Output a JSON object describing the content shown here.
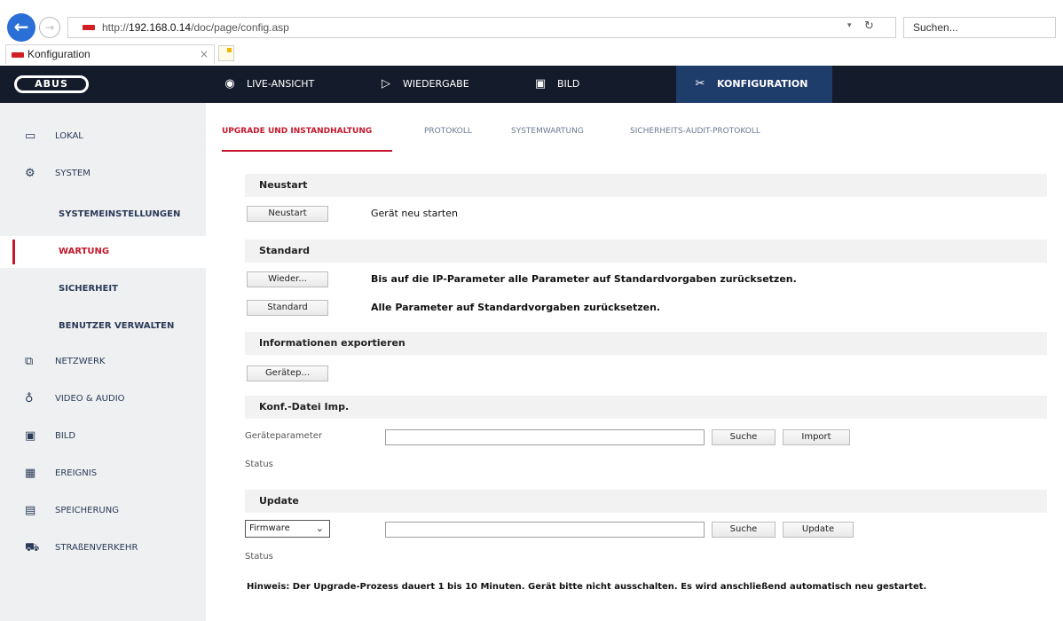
{
  "browser": {
    "url_prefix": "http://",
    "url_host": "192.168.0.14",
    "url_path": "/doc/page/config.asp",
    "address_dropdown_icon": "chevron-down-icon",
    "refresh_icon": "refresh-icon",
    "search_placeholder": "Suchen...",
    "tab_title": "Konfiguration",
    "tab_close": "×"
  },
  "header": {
    "logo": "ABUS",
    "nav": [
      {
        "label": "LIVE-ANSICHT",
        "icon": "eye-icon"
      },
      {
        "label": "WIEDERGABE",
        "icon": "play-icon"
      },
      {
        "label": "BILD",
        "icon": "image-icon"
      },
      {
        "label": "KONFIGURATION",
        "icon": "tools-icon",
        "active": true
      }
    ]
  },
  "sidebar": {
    "items": [
      {
        "label": "LOKAL",
        "icon": "monitor-icon"
      },
      {
        "label": "SYSTEM",
        "icon": "gear-icon"
      },
      {
        "label": "SYSTEMEINSTELLUNGEN"
      },
      {
        "label": "WARTUNG",
        "active": true
      },
      {
        "label": "SICHERHEIT"
      },
      {
        "label": "BENUTZER VERWALTEN"
      },
      {
        "label": "NETZWERK",
        "icon": "network-icon"
      },
      {
        "label": "VIDEO & AUDIO",
        "icon": "microphone-icon"
      },
      {
        "label": "BILD",
        "icon": "image-icon"
      },
      {
        "label": "EREIGNIS",
        "icon": "calendar-icon"
      },
      {
        "label": "SPEICHERUNG",
        "icon": "storage-icon"
      },
      {
        "label": "STRAßENVERKEHR",
        "icon": "vehicle-icon"
      }
    ]
  },
  "main": {
    "tabs": [
      {
        "label": "UPGRADE UND INSTANDHALTUNG",
        "active": true
      },
      {
        "label": "PROTOKOLL"
      },
      {
        "label": "SYSTEMWARTUNG"
      },
      {
        "label": "SICHERHEITS-AUDIT-PROTOKOLL"
      }
    ],
    "sections": {
      "restart": {
        "title": "Neustart",
        "button": "Neustart",
        "description": "Gerät neu starten"
      },
      "default": {
        "title": "Standard",
        "restore_button": "Wieder...",
        "restore_description": "Bis auf die IP-Parameter alle Parameter auf Standardvorgaben zurücksetzen.",
        "default_button": "Standard",
        "default_description": "Alle Parameter auf Standardvorgaben zurücksetzen."
      },
      "export": {
        "title": "Informationen exportieren",
        "button": "Gerätep..."
      },
      "import": {
        "title": "Konf.-Datei Imp.",
        "field_label": "Geräteparameter",
        "file_value": "",
        "browse_button": "Suche",
        "import_button": "Import",
        "status_label": "Status"
      },
      "update": {
        "title": "Update",
        "select_value": "Firmware",
        "file_value": "",
        "browse_button": "Suche",
        "update_button": "Update",
        "status_label": "Status"
      }
    },
    "hint": "Hinweis: Der Upgrade-Prozess dauert 1 bis 10 Minuten. Gerät bitte nicht ausschalten. Es wird anschließend automatisch neu gestartet."
  },
  "colors": {
    "accent": "#c5172b",
    "header_bg": "#141c2b",
    "header_active": "#1f3d6b",
    "sidebar_bg": "#eef0f2"
  }
}
